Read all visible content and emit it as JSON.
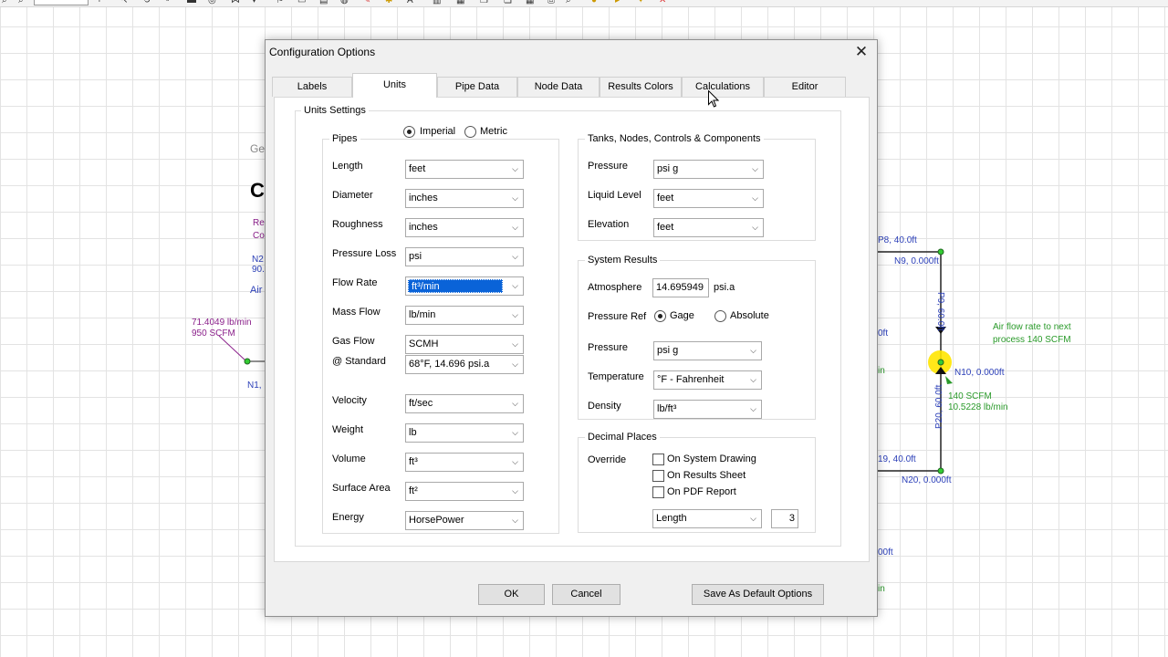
{
  "toolbar": {
    "zoom_value": ""
  },
  "background": {
    "ge_text": "Ge",
    "c_text": "C",
    "re_text": "Re",
    "co_text": "Co",
    "n2_text": "N2",
    "n90_text": "90.",
    "air_text": "Air",
    "flow_left_1": "71.4049 lb/min",
    "flow_left_2": "950 SCFM",
    "n1_text": "N1,",
    "p8_text": "P8, 40.0ft",
    "n9_text": "N9, 0.000ft",
    "p9_text": "P9, 60.0ft",
    "note_1": "Air flow rate to next",
    "note_2": "process 140 SCFM",
    "n10_text": "N10, 0.000ft",
    "flow_right_1": "140 SCFM",
    "flow_right_2": "10.5228 lb/min",
    "p20_text": "P20, 60.0ft",
    "p19_text": "19, 40.0ft",
    "n20_text": "N20, 0.000ft",
    "oft_1": "0ft",
    "in_1": "in",
    "oft_2": "00ft",
    "in_2": "in"
  },
  "dialog": {
    "title": "Configuration Options",
    "tabs": [
      "Labels",
      "Units",
      "Pipe Data",
      "Node Data",
      "Results Colors",
      "Calculations",
      "Editor"
    ],
    "units_settings": "Units Settings",
    "system_imperial": "Imperial",
    "system_metric": "Metric",
    "pipes": {
      "title": "Pipes",
      "rows": [
        {
          "label": "Length",
          "value": "feet"
        },
        {
          "label": "Diameter",
          "value": "inches"
        },
        {
          "label": "Roughness",
          "value": "inches"
        },
        {
          "label": "Pressure Loss",
          "value": "psi"
        },
        {
          "label": "Flow Rate",
          "value": "ft³/min"
        },
        {
          "label": "Mass Flow",
          "value": "lb/min"
        },
        {
          "label": "Gas Flow",
          "value": "SCMH"
        },
        {
          "label": "@ Standard",
          "value": "68°F,  14.696 psi.a"
        },
        {
          "label": "Velocity",
          "value": "ft/sec"
        },
        {
          "label": "Weight",
          "value": "lb"
        },
        {
          "label": "Volume",
          "value": "ft³"
        },
        {
          "label": "Surface Area",
          "value": "ft²"
        },
        {
          "label": "Energy",
          "value": "HorsePower"
        }
      ]
    },
    "tanks": {
      "title": "Tanks, Nodes, Controls & Components",
      "rows": [
        {
          "label": "Pressure",
          "value": "psi g"
        },
        {
          "label": "Liquid Level",
          "value": "feet"
        },
        {
          "label": "Elevation",
          "value": "feet"
        }
      ]
    },
    "system_results": {
      "title": "System Results",
      "atmosphere_label": "Atmosphere",
      "atmosphere_value": "14.695949",
      "atmosphere_unit": "psi.a",
      "pressure_ref_label": "Pressure Ref",
      "gage": "Gage",
      "absolute": "Absolute",
      "rows": [
        {
          "label": "Pressure",
          "value": "psi g"
        },
        {
          "label": "Temperature",
          "value": "°F - Fahrenheit"
        },
        {
          "label": "Density",
          "value": "lb/ft³"
        }
      ]
    },
    "decimal_places": {
      "title": "Decimal Places",
      "override_label": "Override",
      "on_system_drawing": "On System Drawing",
      "on_results_sheet": "On Results Sheet",
      "on_pdf_report": "On PDF Report",
      "field_value": "Length",
      "places_value": "3"
    },
    "buttons": {
      "ok": "OK",
      "cancel": "Cancel",
      "save_default": "Save As Default Options"
    }
  }
}
